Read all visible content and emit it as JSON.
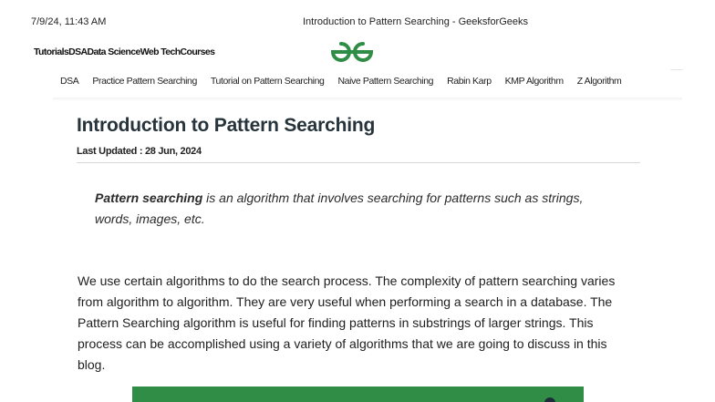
{
  "print_header": {
    "datetime": "7/9/24, 11:43 AM",
    "page_title": "Introduction to Pattern Searching - GeeksforGeeks"
  },
  "top_nav": {
    "items": [
      "Tutorials",
      "DSA",
      "Data Science",
      "Web Tech",
      "Courses"
    ]
  },
  "logo": {
    "name": "geeksforgeeks-logo",
    "color": "#2f8d46"
  },
  "sub_nav": {
    "items": [
      "DSA",
      "Practice Pattern Searching",
      "Tutorial on Pattern Searching",
      "Naive Pattern Searching",
      "Rabin Karp",
      "KMP Algorithm",
      "Z Algorithm"
    ]
  },
  "article": {
    "title": "Introduction to Pattern Searching",
    "last_updated": "Last Updated : 28 Jun, 2024",
    "intro_bold": "Pattern searching",
    "intro_rest": " is an algorithm that involves searching for patterns such as strings, words, images, etc.",
    "body": "We use certain algorithms to do the search process. The complexity of pattern searching varies from algorithm to algorithm. They are very useful when performing a search in a database. The Pattern Searching algorithm is useful for finding patterns in substrings of larger strings. This process can be accomplished using a variety of algorithms that we are going to discuss in this blog."
  },
  "colors": {
    "brand_green": "#2f8d46",
    "title_text": "#27343b"
  }
}
